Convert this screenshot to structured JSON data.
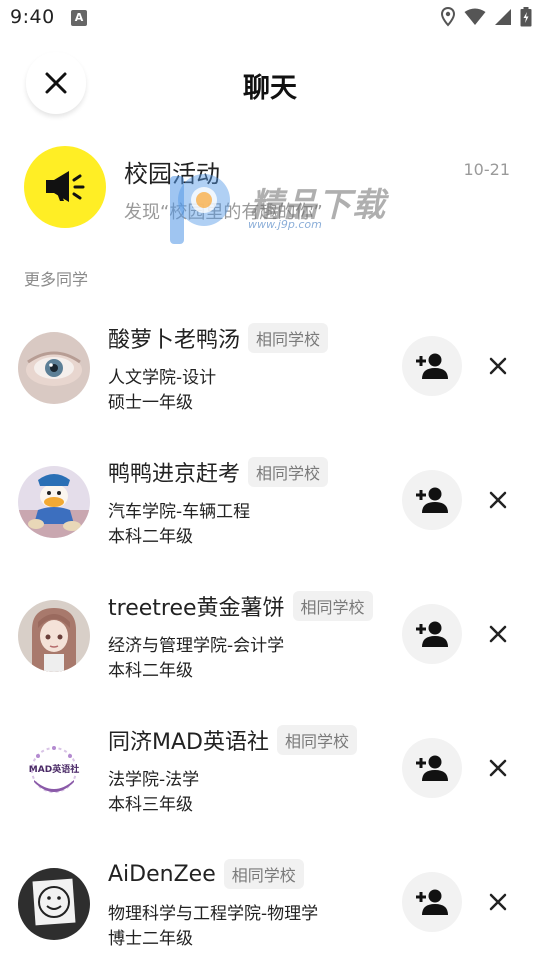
{
  "status_bar": {
    "time": "9:40",
    "notification_letter": "A",
    "icons": [
      "location-icon",
      "wifi-icon",
      "signal-icon",
      "battery-charging-icon"
    ]
  },
  "header": {
    "title": "聊天",
    "close_icon": "close-icon"
  },
  "campus_activity": {
    "name": "校园活动",
    "preview": "发现“校园里的有趣的你”",
    "date": "10-21",
    "avatar_color": "#ffee25",
    "icon": "megaphone-icon"
  },
  "watermark": {
    "text": "精品下载",
    "url": "www.j9p.com"
  },
  "more_classmates": {
    "label": "更多同学",
    "people": [
      {
        "name": "酸萝卜老鸭汤",
        "tag": "相同学校",
        "school": "人文学院-设计",
        "grade": "硕士一年级",
        "avatar": "eye-photo-avatar"
      },
      {
        "name": "鸭鸭进京赶考",
        "tag": "相同学校",
        "school": "汽车学院-车辆工程",
        "grade": "本科二年级",
        "avatar": "duck-cartoon-avatar"
      },
      {
        "name": "treetree黄金薯饼",
        "tag": "相同学校",
        "school": "经济与管理学院-会计学",
        "grade": "本科二年级",
        "avatar": "anime-girl-avatar"
      },
      {
        "name": "同济MAD英语社",
        "tag": "相同学校",
        "school": "法学院-法学",
        "grade": "本科三年级",
        "avatar": "mad-club-logo-avatar",
        "avatar_text": "MAD英语社"
      },
      {
        "name": "AiDenZee",
        "tag": "相同学校",
        "school": "物理科学与工程学院-物理学",
        "grade": "博士二年级",
        "avatar": "smiley-drawing-avatar"
      }
    ]
  },
  "colors": {
    "accent_yellow": "#ffee25",
    "secondary_text": "#9a9a9a",
    "button_bg": "#f2f2f2"
  }
}
